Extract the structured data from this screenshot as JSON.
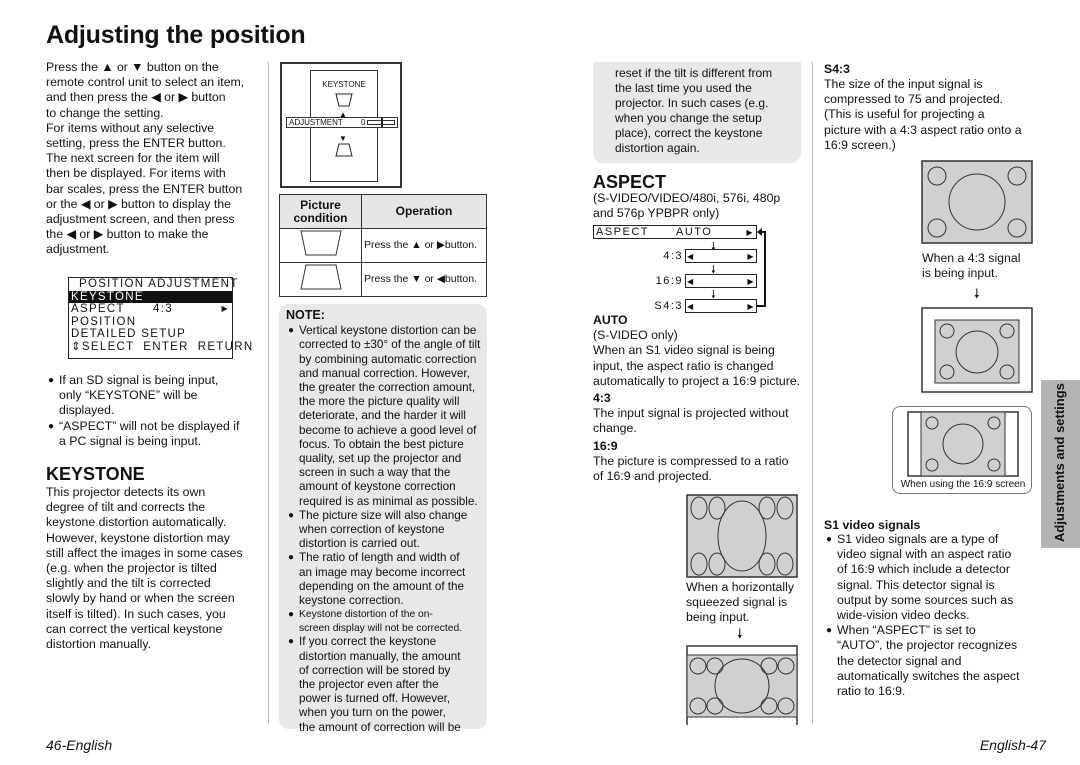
{
  "page": {
    "title": "Adjusting the position",
    "footer_left": "46-English",
    "footer_right": "English-47",
    "side_tab": "Adjustments and settings"
  },
  "left_col": {
    "intro": "Press the ▲ or ▼ button on the\nremote control unit to select an item,\nand then press the ◀ or ▶ button\nto change the setting.\nFor items without any selective\nsetting, press the ENTER button.\nThe next screen for the item will\nthen be displayed. For items with\nbar scales, press the ENTER button\nor the ◀ or ▶ button to display the\nadjustment screen, and then press\nthe ◀ or ▶ button to make the\nadjustment.",
    "osd_menu": {
      "title": "POSITION ADJUSTMENT",
      "items": [
        {
          "label": "KEYSTONE",
          "value": "",
          "selected": true
        },
        {
          "label": "ASPECT",
          "value": "4:3",
          "selected": false
        },
        {
          "label": "POSITION",
          "value": "",
          "selected": false
        },
        {
          "label": "DETAILED SETUP",
          "value": "",
          "selected": false
        }
      ],
      "footer": "⇕SELECT  ENTER  RETURN"
    },
    "bullets": [
      "If an SD signal is being input,\nonly “KEYSTONE” will be\ndisplayed.",
      "“ASPECT” will not be displayed if\na PC signal is being input."
    ],
    "keystone_heading": "KEYSTONE",
    "keystone_body": "This projector detects its own\ndegree of tilt and corrects the\nkeystone distortion automatically.\nHowever, keystone distortion may\nstill affect the images in some cases\n(e.g. when the projector is tilted\nslightly and the tilt is corrected\nslowly by hand or when the screen\nitself is tilted). In such cases, you\ncan correct the vertical keystone\ndistortion manually."
  },
  "mid_col": {
    "keystone_figure": {
      "label": "KEYSTONE",
      "adjustment_label": "ADJUSTMENT",
      "adjustment_value": "0",
      "slider_fraction": 0.5
    },
    "op_table": {
      "headers": [
        "Picture\ncondition",
        "Operation"
      ],
      "rows": [
        {
          "condition_icon": "trapezoid-wide-top-icon",
          "operation": "Press the ▲ or ▶button."
        },
        {
          "condition_icon": "trapezoid-wide-bottom-icon",
          "operation": "Press the ▼ or ◀button."
        }
      ]
    },
    "note": {
      "heading": "NOTE:",
      "bullets": [
        {
          "text": "Vertical keystone distortion can be\ncorrected to ±30° of the angle of tilt\nby combining automatic correction\nand manual correction. However,\nthe greater the correction amount,\nthe more the picture quality will\ndeteriorate, and the harder it will\nbecome to achieve a good level of\nfocus. To obtain the best picture\nquality, set up the projector and\nscreen in such a way that the\namount of keystone correction\nrequired is as minimal as possible.",
          "small": false
        },
        {
          "text": "The picture size will also change\nwhen correction of keystone\ndistortion is carried out.",
          "small": false
        },
        {
          "text": "The ratio of length and width of\nan image may become incorrect\ndepending on the amount of the\nkeystone correction.",
          "small": false
        },
        {
          "text": "Keystone distortion of the on-\nscreen display will not be corrected.",
          "small": true
        },
        {
          "text": "If you correct the keystone\ndistortion manually, the amount\nof correction will be stored by\nthe projector even after the\npower is turned off. However,\nwhen you turn on the power,\nthe amount of correction will be",
          "small": false
        }
      ],
      "continued": "reset if the tilt is different from\nthe last time you used the\nprojector. In such cases (e.g.\nwhen you change the setup\nplace), correct the keystone\ndistortion again."
    }
  },
  "aspect_col": {
    "heading": "ASPECT",
    "subtitle": "(S-VIDEO/VIDEO/480i, 576i, 480p\nand 576p YPBPR only)",
    "menu": {
      "label": "ASPECT",
      "value": "AUTO",
      "options": [
        "4:3",
        "16:9",
        "S4:3"
      ]
    },
    "modes": [
      {
        "name": "AUTO",
        "body": "(S-VIDEO only)\nWhen an S1 video signal is being\ninput, the aspect ratio is changed\nautomatically to project a 16:9 picture."
      },
      {
        "name": "4:3",
        "body": "The input signal is projected without\nchange."
      },
      {
        "name": "16:9",
        "body": "The picture is compressed to a ratio\nof 16:9 and projected."
      }
    ],
    "squeezed_caption": "When a horizontally\nsqueezed signal is\nbeing input."
  },
  "right_col": {
    "s43_heading": "S4:3",
    "s43_body": "The size of the input signal is\ncompressed to 75 and projected.\n(This is useful for projecting a\npicture with a 4:3 aspect ratio onto a\n16:9 screen.)",
    "caption_43": "When a 4:3 signal\nis being input.",
    "caption_169_screen": "When using the 16:9 screen",
    "s1_heading": "S1 video signals",
    "s1_bullets": [
      "S1 video signals are a type of\nvideo signal with an aspect ratio\nof 16:9 which include a detector\nsignal. This detector signal is\noutput by some sources such as\nwide-vision video decks.",
      "When “ASPECT” is set to\n“AUTO”, the projector recognizes\nthe detector signal and\nautomatically switches the aspect\nratio to 16:9."
    ]
  },
  "colors": {
    "note_bg": "#e8e8e8",
    "picture_bg": "#d0d0d0",
    "tab_bg": "#b4b4b4",
    "osd_highlight": "#111111"
  }
}
